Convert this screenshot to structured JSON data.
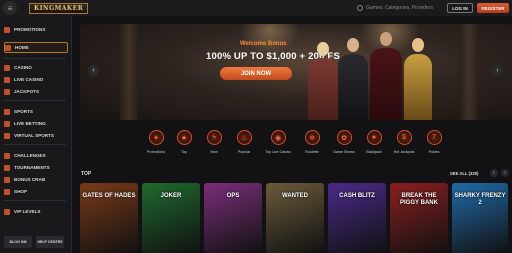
{
  "header": {
    "logo_text": "KINGMAKER",
    "search_placeholder": "Games, Categories, Providers",
    "login_label": "LOG IN",
    "register_label": "REGISTER"
  },
  "sidebar": {
    "items": [
      {
        "label": "PROMOTIONS"
      },
      {
        "label": "HOME"
      },
      {
        "label": "CASINO"
      },
      {
        "label": "LIVE CASINO"
      },
      {
        "label": "JACKPOTS"
      },
      {
        "label": "SPORTS"
      },
      {
        "label": "LIVE BETTING"
      },
      {
        "label": "VIRTUAL SPORTS"
      },
      {
        "label": "CHALLENGES"
      },
      {
        "label": "TOURNAMENTS"
      },
      {
        "label": "BONUS CRAB"
      },
      {
        "label": "SHOP"
      },
      {
        "label": "VIP LEVELS"
      }
    ],
    "bottom": {
      "blog_label": "BLOG KM",
      "help_label": "HELP CENTRE"
    }
  },
  "banner": {
    "title": "Welcome Bonus",
    "amount": "100% UP TO $1,000 + 200 FS",
    "cta_label": "JOIN NOW"
  },
  "categories": [
    {
      "label": "Promotions"
    },
    {
      "label": "Top"
    },
    {
      "label": "New"
    },
    {
      "label": "Popular"
    },
    {
      "label": "Top Live Casino"
    },
    {
      "label": "Roulette"
    },
    {
      "label": "Game Shows"
    },
    {
      "label": "Blackjack"
    },
    {
      "label": "Hot Jackpots"
    },
    {
      "label": "Pokies"
    }
  ],
  "top_section": {
    "title": "TOP",
    "see_all_label": "SEE ALL (329)",
    "games": [
      {
        "name": "GATES OF HADES",
        "color": "#7a3a18"
      },
      {
        "name": "JOKER",
        "color": "#1f6a2f"
      },
      {
        "name": "OPS",
        "color": "#7a2f7a"
      },
      {
        "name": "WANTED",
        "color": "#6a5a3a"
      },
      {
        "name": "CASH BLITZ",
        "color": "#4a2a8a"
      },
      {
        "name": "BREAK THE PIGGY BANK",
        "color": "#8a1f1f"
      },
      {
        "name": "SHARKY FRENZY 2",
        "color": "#1f6aa8"
      }
    ]
  }
}
